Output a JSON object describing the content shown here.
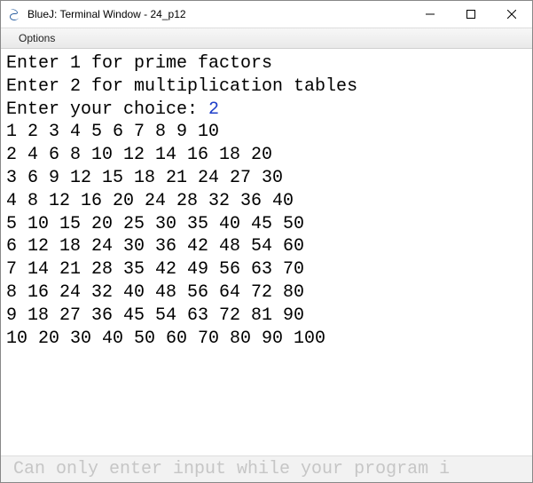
{
  "window": {
    "title": "BlueJ: Terminal Window - 24_p12"
  },
  "menu": {
    "options": "Options"
  },
  "terminal": {
    "prompt1": "Enter 1 for prime factors",
    "prompt2": "Enter 2 for multiplication tables",
    "prompt3": "Enter your choice: ",
    "user_input": "2",
    "rows": [
      "1 2 3 4 5 6 7 8 9 10",
      "2 4 6 8 10 12 14 16 18 20",
      "3 6 9 12 15 18 21 24 27 30",
      "4 8 12 16 20 24 28 32 36 40",
      "5 10 15 20 25 30 35 40 45 50",
      "6 12 18 24 30 36 42 48 54 60",
      "7 14 21 28 35 42 49 56 63 70",
      "8 16 24 32 40 48 56 64 72 80",
      "9 18 27 36 45 54 63 72 81 90",
      "10 20 30 40 50 60 70 80 90 100"
    ]
  },
  "input_placeholder": "Can only enter input while your program i"
}
